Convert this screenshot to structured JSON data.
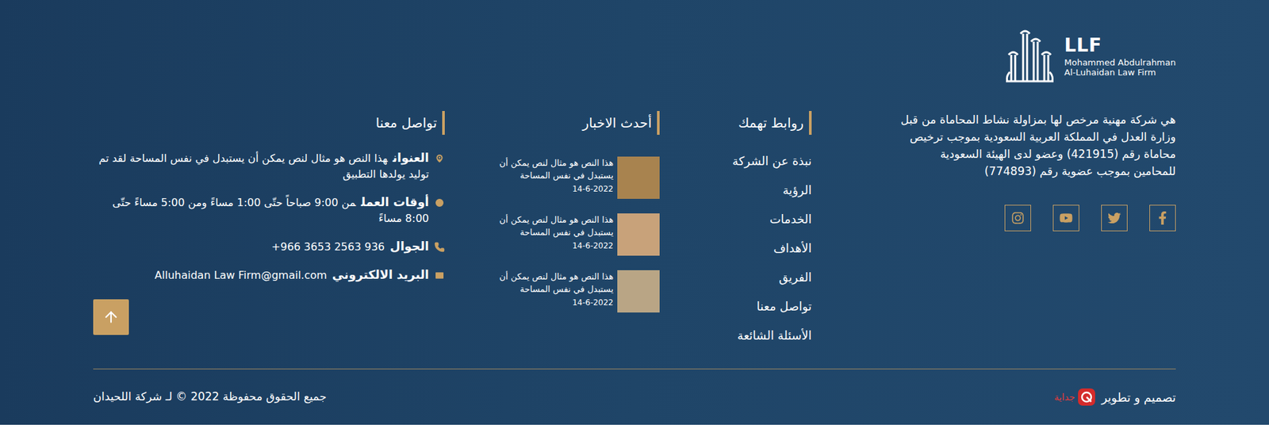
{
  "logo": {
    "abbr": "LLF",
    "name_line1": "Mohammed Abdulrahman",
    "name_line2": "Al-Luhaidan Law Firm"
  },
  "about": "هي شركة مهنية مرخص لها بمزاولة نشاط المحاماة من قبل وزارة العدل في المملكة العربية السعودية بموجب ترخيص محاماة رقم (421915) وعضو لدى الهيئة السعودية للمحامين بموجب عضوية رقم (774893)",
  "social": [
    {
      "kind": "facebook"
    },
    {
      "kind": "twitter"
    },
    {
      "kind": "youtube"
    },
    {
      "kind": "instagram"
    }
  ],
  "links": {
    "heading": "روابط تهمك",
    "items": [
      "نبذة عن الشركة",
      "الرؤية",
      "الخدمات",
      "الأهداف",
      "الفريق",
      "تواصل معنا",
      "الأسئلة الشائعة"
    ]
  },
  "news": {
    "heading": "أحدث الاخبار",
    "items": [
      {
        "text": "هذا النص هو مثال لنص يمكن أن يستبدل في نفس المساحة",
        "date": "14-6-2022"
      },
      {
        "text": "هذا النص هو مثال لنص يمكن أن يستبدل في نفس المساحة",
        "date": "14-6-2022"
      },
      {
        "text": "هذا النص هو مثال لنص يمكن أن يستبدل في نفس المساحة",
        "date": "14-6-2022"
      }
    ]
  },
  "contact": {
    "heading": "تواصل معنا",
    "rows": [
      {
        "kind": "address",
        "label": "العنوان",
        "value": "هذا النص هو مثال لنص يمكن أن يستبدل في نفس المساحة لقد تم توليد يولدها التطبيق"
      },
      {
        "kind": "hours",
        "label": "أوقات العمل",
        "value": "من 9:00 صباحاً حتّى 1:00 مساءً ومن 5:00 مساءً حتّى 8:00 مساءً"
      },
      {
        "kind": "phone",
        "label": "الجوال",
        "value": "+966 3653 2563 936"
      },
      {
        "kind": "email",
        "label": "البريد الالكتروني",
        "value": "Alluhaidan Law Firm@gmail.com"
      }
    ]
  },
  "footer": {
    "credit": "تصميم و تطوير",
    "partner": "جداية",
    "copyright": "جميع الحقوق محفوظة 2022 © لـ شركة اللحيدان"
  }
}
